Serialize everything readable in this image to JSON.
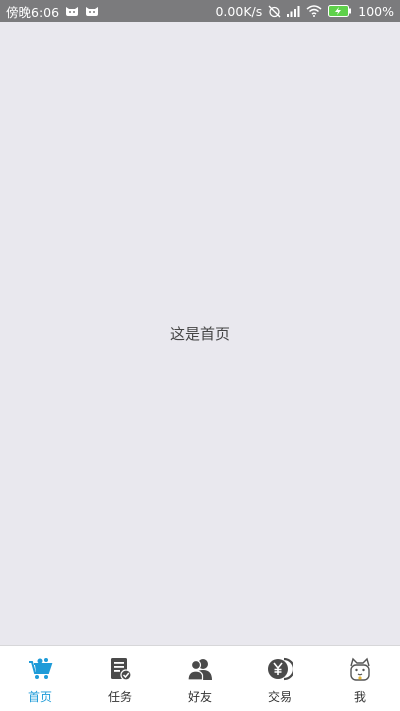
{
  "status_bar": {
    "time": "傍晚6:06",
    "speed": "0.00K/s",
    "battery": "100%",
    "icons": [
      "cat-icon",
      "cat-icon",
      "alarm-off-icon",
      "signal-icon",
      "wifi-icon",
      "battery-charging-icon"
    ]
  },
  "main": {
    "text": "这是首页"
  },
  "tabs": [
    {
      "label": "首页",
      "icon": "basket-icon",
      "active": true
    },
    {
      "label": "任务",
      "icon": "task-list-icon",
      "active": false
    },
    {
      "label": "好友",
      "icon": "friends-icon",
      "active": false
    },
    {
      "label": "交易",
      "icon": "yen-coin-icon",
      "active": false
    },
    {
      "label": "我",
      "icon": "lucky-cat-icon",
      "active": false
    }
  ],
  "colors": {
    "accent": "#1e9bd8",
    "background": "#e9e8ee",
    "status_bar": "#7b7b7d",
    "icon_gray": "#4a4a4a"
  }
}
